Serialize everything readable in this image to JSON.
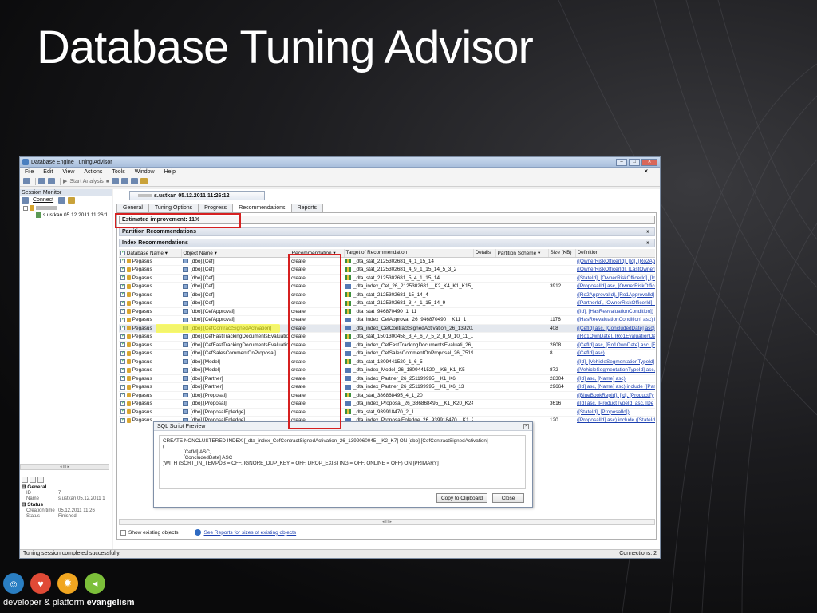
{
  "slide": {
    "title": "Database Tuning Advisor",
    "brand_tagline_plain": "developer & platform ",
    "brand_tagline_bold": "evangelism"
  },
  "app": {
    "window_title": "Database Engine Tuning Advisor",
    "menu": [
      "File",
      "Edit",
      "View",
      "Actions",
      "Tools",
      "Window",
      "Help"
    ],
    "toolbar_start_analysis": "Start Analysis",
    "session_monitor": "Session Monitor",
    "connect_label": "Connect",
    "tree_session": "s.ustkan 05.12.2011 11:26:1",
    "session_tab": "s.ustkan 05.12.2011 11:26:12",
    "tabs": [
      "General",
      "Tuning Options",
      "Progress",
      "Recommendations",
      "Reports"
    ],
    "estimated_improvement": "Estimated improvement:  11%",
    "partition_recs": "Partition Recommendations",
    "index_recs": "Index Recommendations",
    "columns": {
      "db": "Database Name",
      "obj": "Object Name",
      "rec": "Recommendation",
      "target": "Target of Recommendation",
      "details": "Details",
      "scheme": "Partition Scheme",
      "size": "Size (KB)",
      "def": "Definition"
    },
    "rows": [
      {
        "db": "Pegasus",
        "obj": "[dbo].[Cef]",
        "rec": "create",
        "target": "_dta_stat_2125302681_4_1_15_14",
        "size": "",
        "def": "([OwnerRiskOfficerId], [Id], [Ro2Ap",
        "kind": "stat"
      },
      {
        "db": "Pegasus",
        "obj": "[dbo].[Cef]",
        "rec": "create",
        "target": "_dta_stat_2125302681_4_9_1_15_14_5_3_2",
        "size": "",
        "def": "([OwnerRiskOfficerId], [LastOwnerR",
        "kind": "stat"
      },
      {
        "db": "Pegasus",
        "obj": "[dbo].[Cef]",
        "rec": "create",
        "target": "_dta_stat_2125302681_5_4_1_15_14",
        "size": "",
        "def": "([StateId], [OwnerRiskOfficerId], [Id",
        "kind": "stat"
      },
      {
        "db": "Pegasus",
        "obj": "[dbo].[Cef]",
        "rec": "create",
        "target": "_dta_index_Cef_26_2125302681__K2_K4_K1_K15_...",
        "size": "3912",
        "def": "([ProposalId] asc, [OwnerRiskOffice",
        "kind": "index"
      },
      {
        "db": "Pegasus",
        "obj": "[dbo].[Cef]",
        "rec": "create",
        "target": "_dta_stat_2125302681_15_14_4",
        "size": "",
        "def": "([Ro2ApprovalId], [Ro1ApprovalId],",
        "kind": "stat"
      },
      {
        "db": "Pegasus",
        "obj": "[dbo].[Cef]",
        "rec": "create",
        "target": "_dta_stat_2125302681_3_4_1_15_14_9",
        "size": "",
        "def": "([PartnerId], [OwnerRiskOfficerId], [",
        "kind": "stat"
      },
      {
        "db": "Pegasus",
        "obj": "[dbo].[CefApproval]",
        "rec": "create",
        "target": "_dta_stat_946870490_1_11",
        "size": "",
        "def": "([Id], [HasReevaluationCondition])",
        "kind": "stat"
      },
      {
        "db": "Pegasus",
        "obj": "[dbo].[CefApproval]",
        "rec": "create",
        "target": "_dta_index_CefApproval_26_946870490__K11_1",
        "size": "1176",
        "def": "([HasReevaluationCondition] asc) i",
        "kind": "index"
      },
      {
        "db": "Pegasus",
        "obj": "[dbo].[CefContractSignedActivation]",
        "rec": "create",
        "target": "_dta_index_CefContractSignedActivation_26_13920...",
        "size": "408",
        "def": "([CefId] asc, [ConcludedDate] asc)",
        "kind": "index",
        "selected": true
      },
      {
        "db": "Pegasus",
        "obj": "[dbo].[CefFastTrackingDocumentsEvaluation]",
        "rec": "create",
        "target": "_dta_stat_1501300458_3_4_6_7_5_2_8_9_10_11_...",
        "size": "",
        "def": "([Ro1OwnDate], [Ro1EvaluationDa",
        "kind": "stat"
      },
      {
        "db": "Pegasus",
        "obj": "[dbo].[CefFastTrackingDocumentsEvaluation]",
        "rec": "create",
        "target": "_dta_index_CefFastTrackingDocumentsEvaluati_26_...",
        "size": "2808",
        "def": "([CefId] asc, [Ro1OwnDate] asc, [F",
        "kind": "index"
      },
      {
        "db": "Pegasus",
        "obj": "[dbo].[CefSalesCommentOnProposal]",
        "rec": "create",
        "target": "_dta_index_CefSalesCommentOnProposal_26_75199...",
        "size": "8",
        "def": "([CefId] asc)",
        "kind": "index"
      },
      {
        "db": "Pegasus",
        "obj": "[dbo].[Model]",
        "rec": "create",
        "target": "_dta_stat_1809441520_1_6_5",
        "size": "",
        "def": "([Id], [VehicleSegmentationTypeId]",
        "kind": "stat"
      },
      {
        "db": "Pegasus",
        "obj": "[dbo].[Model]",
        "rec": "create",
        "target": "_dta_index_Model_26_1809441520__K6_K1_K5",
        "size": "872",
        "def": "([VehicleSegmentationTypeId] asc,",
        "kind": "index"
      },
      {
        "db": "Pegasus",
        "obj": "[dbo].[Partner]",
        "rec": "create",
        "target": "_dta_index_Partner_26_251199995__K1_K6",
        "size": "28304",
        "def": "([Id] asc, [Name] asc)",
        "kind": "index"
      },
      {
        "db": "Pegasus",
        "obj": "[dbo].[Partner]",
        "rec": "create",
        "target": "_dta_index_Partner_26_251199995__K1_K6_13",
        "size": "29664",
        "def": "([Id] asc, [Name] asc) include ([Part",
        "kind": "index"
      },
      {
        "db": "Pegasus",
        "obj": "[dbo].[Proposal]",
        "rec": "create",
        "target": "_dta_stat_386868495_4_1_20",
        "size": "",
        "def": "([BlueBookRepId], [Id], [ProductTy",
        "kind": "stat"
      },
      {
        "db": "Pegasus",
        "obj": "[dbo].[Proposal]",
        "rec": "create",
        "target": "_dta_index_Proposal_26_386868495__K1_K20_K24...",
        "size": "3616",
        "def": "([Id] asc, [ProductTypeId] asc, [De",
        "kind": "index"
      },
      {
        "db": "Pegasus",
        "obj": "[dbo].[ProposalEpledge]",
        "rec": "create",
        "target": "_dta_stat_939918470_2_1",
        "size": "",
        "def": "([StateId], [ProposalId])",
        "kind": "stat"
      },
      {
        "db": "Pegasus",
        "obj": "[dbo].[ProposalEpledge]",
        "rec": "create",
        "target": "_dta_index_ProposalEpledge_26_939918470__K1_2",
        "size": "120",
        "def": "([ProposalId] asc) include ([StateId]",
        "kind": "index"
      }
    ],
    "sql_preview": {
      "title": "SQL Script Preview",
      "line1": "CREATE NONCLUSTERED INDEX [_dta_index_CefContractSignedActivation_26_1392060045__K2_K7] ON [dbo].[CefContractSignedActivation]",
      "line2": "(",
      "line3": "[CefId] ASC,",
      "line4": "[ConcludedDate] ASC",
      "line5": ")WITH (SORT_IN_TEMPDB = OFF, IGNORE_DUP_KEY = OFF, DROP_EXISTING = OFF, ONLINE = OFF) ON [PRIMARY]",
      "copy_button": "Copy to Clipboard",
      "close_button": "Close"
    },
    "show_existing": "Show existing objects",
    "reports_link": "See Reports for sizes of existing objects",
    "properties": {
      "general": "General",
      "id_label": "ID",
      "id_value": "7",
      "name_label": "Name",
      "name_value": "s.ustkan 05.12.2011 1",
      "status_section": "Status",
      "creation_label": "Creation time",
      "creation_value": "05.12.2011 11:26",
      "status_label": "Status",
      "status_value": "Finished"
    },
    "status_left": "Tuning session completed successfully.",
    "status_right": "Connections: 2"
  },
  "colors": {
    "highlight_red": "#d62020",
    "highlight_yellow": "#ffff00",
    "link": "#1b3fb0"
  }
}
